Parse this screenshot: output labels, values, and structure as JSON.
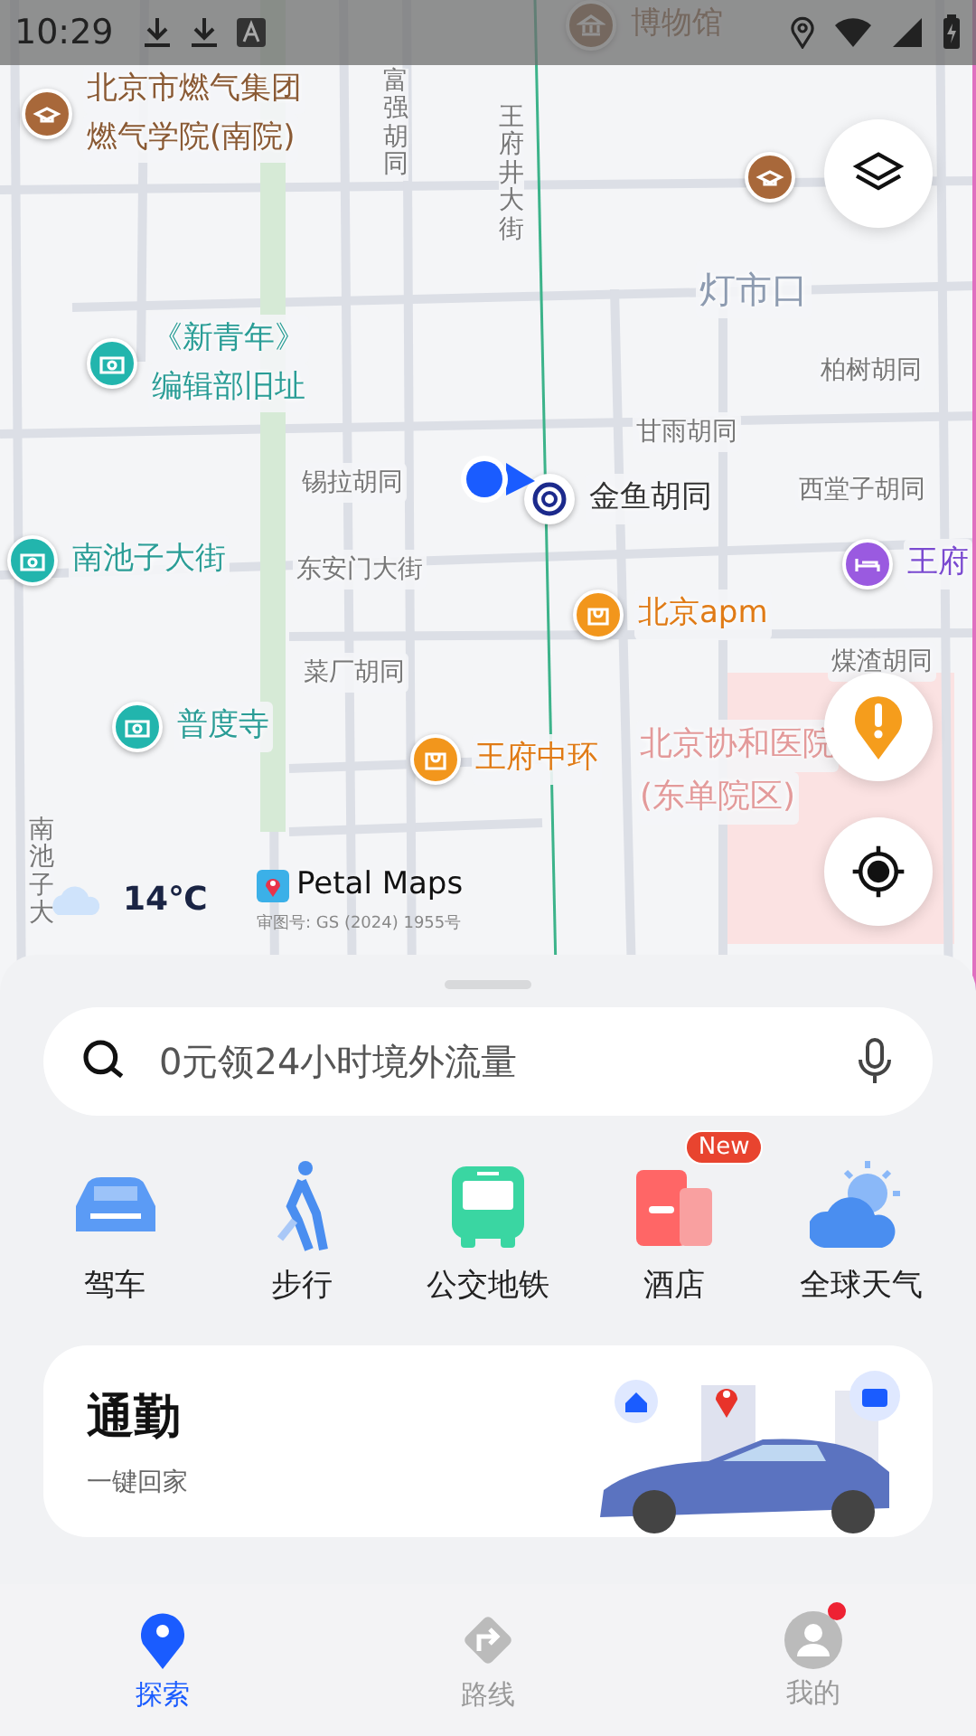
{
  "status_bar": {
    "time": "10:29"
  },
  "map": {
    "labels": [
      {
        "kind": "school",
        "lines": [
          "北京市燃气集团",
          "燃气学院(南院)"
        ]
      },
      {
        "kind": "museum",
        "lines": [
          "博物馆"
        ]
      },
      {
        "kind": "street_vertical",
        "lines": [
          "富强胡同"
        ]
      },
      {
        "kind": "street_vertical",
        "lines": [
          "王府井大街"
        ]
      },
      {
        "kind": "area",
        "lines": [
          "灯市口"
        ]
      },
      {
        "kind": "school"
      },
      {
        "kind": "street",
        "lines": [
          "柏树胡同"
        ]
      },
      {
        "kind": "street",
        "lines": [
          "甘雨胡同"
        ]
      },
      {
        "kind": "camera",
        "lines": [
          "《新青年》",
          "编辑部旧址"
        ]
      },
      {
        "kind": "street",
        "lines": [
          "锡拉胡同"
        ]
      },
      {
        "kind": "subway",
        "lines": [
          "金鱼胡同"
        ]
      },
      {
        "kind": "street",
        "lines": [
          "西堂子胡同"
        ]
      },
      {
        "kind": "camera",
        "lines": [
          "南池子大街"
        ]
      },
      {
        "kind": "street",
        "lines": [
          "东安门大街"
        ]
      },
      {
        "kind": "hotel",
        "lines": [
          "王府"
        ]
      },
      {
        "kind": "shop",
        "lines": [
          "北京apm"
        ]
      },
      {
        "kind": "street",
        "lines": [
          "菜厂胡同"
        ]
      },
      {
        "kind": "street",
        "lines": [
          "煤渣胡同"
        ]
      },
      {
        "kind": "camera",
        "lines": [
          "普度寺"
        ]
      },
      {
        "kind": "shop",
        "lines": [
          "王府中环"
        ]
      },
      {
        "kind": "hospital",
        "lines": [
          "北京协和医院",
          "(东单院区)"
        ]
      },
      {
        "kind": "street_vertical",
        "lines": [
          "南池子大"
        ]
      }
    ],
    "weather": {
      "temperature": "14℃"
    },
    "brand": "Petal Maps",
    "approval": "审图号: GS (2024) 1955号"
  },
  "search": {
    "placeholder": "0元领24小时境外流量"
  },
  "shortcuts": [
    {
      "kind": "car",
      "label": "驾车"
    },
    {
      "kind": "walk",
      "label": "步行"
    },
    {
      "kind": "bus",
      "label": "公交地铁"
    },
    {
      "kind": "hotel",
      "label": "酒店",
      "badge": "New"
    },
    {
      "kind": "weather",
      "label": "全球天气"
    }
  ],
  "commute": {
    "title": "通勤",
    "subtitle": "一键回家"
  },
  "nav": [
    {
      "kind": "explore",
      "label": "探索",
      "selected": true,
      "badge": false
    },
    {
      "kind": "route",
      "label": "路线",
      "selected": false,
      "badge": false
    },
    {
      "kind": "me",
      "label": "我的",
      "selected": false,
      "badge": true
    }
  ]
}
